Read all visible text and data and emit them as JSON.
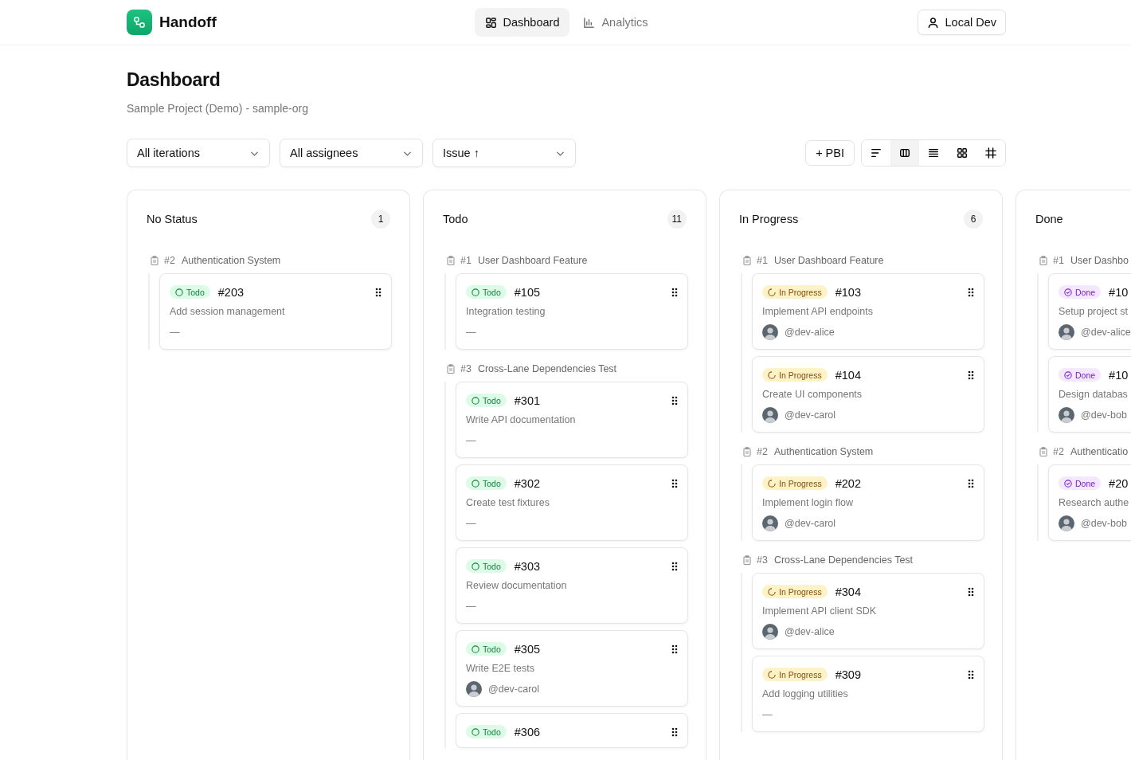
{
  "app": {
    "name": "Handoff"
  },
  "nav": [
    {
      "label": "Dashboard",
      "kind": "dashboard",
      "selected": true
    },
    {
      "label": "Analytics",
      "kind": "analytics",
      "selected": false
    }
  ],
  "user_button": "Local Dev",
  "page": {
    "title": "Dashboard",
    "subtitle": "Sample Project (Demo) - sample-org"
  },
  "filters": [
    "All iterations",
    "All assignees",
    "Issue ↑"
  ],
  "add_button": "+ PBI",
  "view_modes": [
    {
      "kind": "list",
      "selected": false
    },
    {
      "kind": "board",
      "selected": true
    },
    {
      "kind": "rows",
      "selected": false
    },
    {
      "kind": "grid",
      "selected": false
    },
    {
      "kind": "table",
      "selected": false
    }
  ],
  "columns": [
    {
      "title": "No Status",
      "count": "1",
      "groups": [
        {
          "ref": "#2",
          "title": "Authentication System",
          "cards": [
            {
              "status": {
                "kind": "todo",
                "label": "Todo"
              },
              "id": "#203",
              "title": "Add session management",
              "assignee": {
                "name": "—",
                "avatar": false
              }
            }
          ]
        }
      ]
    },
    {
      "title": "Todo",
      "count": "11",
      "groups": [
        {
          "ref": "#1",
          "title": "User Dashboard Feature",
          "cards": [
            {
              "status": {
                "kind": "todo",
                "label": "Todo"
              },
              "id": "#105",
              "title": "Integration testing",
              "assignee": {
                "name": "—",
                "avatar": false
              }
            }
          ]
        },
        {
          "ref": "#3",
          "title": "Cross-Lane Dependencies Test",
          "cards": [
            {
              "status": {
                "kind": "todo",
                "label": "Todo"
              },
              "id": "#301",
              "title": "Write API documentation",
              "assignee": {
                "name": "—",
                "avatar": false
              }
            },
            {
              "status": {
                "kind": "todo",
                "label": "Todo"
              },
              "id": "#302",
              "title": "Create test fixtures",
              "assignee": {
                "name": "—",
                "avatar": false
              }
            },
            {
              "status": {
                "kind": "todo",
                "label": "Todo"
              },
              "id": "#303",
              "title": "Review documentation",
              "assignee": {
                "name": "—",
                "avatar": false
              }
            },
            {
              "status": {
                "kind": "todo",
                "label": "Todo"
              },
              "id": "#305",
              "title": "Write E2E tests",
              "assignee": {
                "name": "@dev-carol",
                "avatar": true
              }
            },
            {
              "status": {
                "kind": "todo",
                "label": "Todo"
              },
              "id": "#306"
            }
          ]
        }
      ]
    },
    {
      "title": "In Progress",
      "count": "6",
      "groups": [
        {
          "ref": "#1",
          "title": "User Dashboard Feature",
          "cards": [
            {
              "status": {
                "kind": "in_progress",
                "label": "In Progress"
              },
              "id": "#103",
              "title": "Implement API endpoints",
              "assignee": {
                "name": "@dev-alice",
                "avatar": true
              }
            },
            {
              "status": {
                "kind": "in_progress",
                "label": "In Progress"
              },
              "id": "#104",
              "title": "Create UI components",
              "assignee": {
                "name": "@dev-carol",
                "avatar": true
              }
            }
          ]
        },
        {
          "ref": "#2",
          "title": "Authentication System",
          "cards": [
            {
              "status": {
                "kind": "in_progress",
                "label": "In Progress"
              },
              "id": "#202",
              "title": "Implement login flow",
              "assignee": {
                "name": "@dev-carol",
                "avatar": true
              }
            }
          ]
        },
        {
          "ref": "#3",
          "title": "Cross-Lane Dependencies Test",
          "cards": [
            {
              "status": {
                "kind": "in_progress",
                "label": "In Progress"
              },
              "id": "#304",
              "title": "Implement API client SDK",
              "assignee": {
                "name": "@dev-alice",
                "avatar": true
              }
            },
            {
              "status": {
                "kind": "in_progress",
                "label": "In Progress"
              },
              "id": "#309",
              "title": "Add logging utilities",
              "assignee": {
                "name": "—",
                "avatar": false
              }
            }
          ]
        }
      ]
    },
    {
      "title": "Done",
      "groups": [
        {
          "ref": "#1",
          "title": "User Dashbo",
          "cards": [
            {
              "status": {
                "kind": "done",
                "label": "Done"
              },
              "id": "#10",
              "title": "Setup project st",
              "assignee": {
                "name": "@dev-alice",
                "avatar": true
              }
            },
            {
              "status": {
                "kind": "done",
                "label": "Done"
              },
              "id": "#10",
              "title": "Design databas",
              "assignee": {
                "name": "@dev-bob",
                "avatar": true
              }
            }
          ]
        },
        {
          "ref": "#2",
          "title": "Authenticatio",
          "cards": [
            {
              "status": {
                "kind": "done",
                "label": "Done"
              },
              "id": "#20",
              "title": "Research authe",
              "assignee": {
                "name": "@dev-bob",
                "avatar": true
              }
            }
          ]
        }
      ]
    }
  ]
}
